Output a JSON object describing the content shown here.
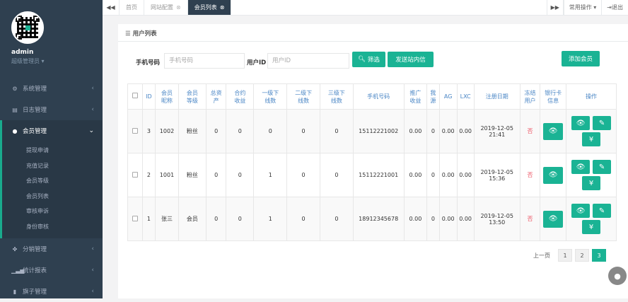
{
  "user": {
    "name": "admin",
    "role": "超级管理员 ▾"
  },
  "nav": [
    {
      "icon": "gear-icon",
      "glyph": "⚙",
      "label": "系统管理",
      "chev": "‹",
      "active": false
    },
    {
      "icon": "calendar-icon",
      "glyph": "▤",
      "label": "日志管理",
      "chev": "‹",
      "active": false
    },
    {
      "icon": "user-icon",
      "glyph": "●",
      "label": "会员管理",
      "chev": "⌄",
      "active": true
    },
    {
      "icon": "share-icon",
      "glyph": "✤",
      "label": "分销管理",
      "chev": "‹",
      "active": false
    },
    {
      "icon": "chart-icon",
      "glyph": "▁▃▅",
      "label": "统计报表",
      "chev": "‹",
      "active": false
    },
    {
      "icon": "book-icon",
      "glyph": "▮",
      "label": "旗子管理",
      "chev": "‹",
      "active": false
    }
  ],
  "submenu": [
    "提现申请",
    "充值记录",
    "会员等级",
    "会员列表",
    "审核申诉",
    "身份审核"
  ],
  "topbar": {
    "back": "◀◀",
    "forward": "▶▶",
    "tabs": [
      {
        "label": "首页",
        "close": ""
      },
      {
        "label": "网站配置",
        "close": "⊗"
      },
      {
        "label": "会员列表",
        "close": "⊗"
      }
    ],
    "common_ops": "常用操作 ▾",
    "logout": "⇥退出"
  },
  "panel": {
    "title": "用户列表",
    "title_icon": "☰"
  },
  "filter": {
    "phone_label": "手机号码",
    "phone_placeholder": "手机号码",
    "uid_label": "用户ID",
    "uid_placeholder": "用户ID",
    "filter_btn": "筛选",
    "send_btn": "发送站内信",
    "add_btn": "添加会员"
  },
  "table": {
    "headers": [
      "ID",
      "会员\n昵称",
      "会员\n等级",
      "总资\n产",
      "合约\n收益",
      "一级下\n线数",
      "二级下\n线数",
      "三级下\n线数",
      "手机号码",
      "推广\n收益",
      "我\n源",
      "AG",
      "LXC",
      "注册日期",
      "冻结\n用户",
      "银行卡\n信息",
      "操作"
    ],
    "rows": [
      {
        "id": "3",
        "nick": "1002",
        "level": "粉丝",
        "assets": "0",
        "contract": "0",
        "l1": "0",
        "l2": "0",
        "l3": "0",
        "phone": "15112221002",
        "promo": "0.00",
        "src": "0",
        "ag": "0.00",
        "lxc": "0.00",
        "date": "2019-12-05\n21:41",
        "frozen": "否"
      },
      {
        "id": "2",
        "nick": "1001",
        "level": "粉丝",
        "assets": "0",
        "contract": "0",
        "l1": "1",
        "l2": "0",
        "l3": "0",
        "phone": "15112221001",
        "promo": "0.00",
        "src": "0",
        "ag": "0.00",
        "lxc": "0.00",
        "date": "2019-12-05\n15:36",
        "frozen": "否"
      },
      {
        "id": "1",
        "nick": "张三",
        "level": "会员",
        "assets": "0",
        "contract": "0",
        "l1": "1",
        "l2": "0",
        "l3": "0",
        "phone": "18912345678",
        "promo": "0.00",
        "src": "0",
        "ag": "0.00",
        "lxc": "0.00",
        "date": "2019-12-05\n13:50",
        "frozen": "否"
      }
    ]
  },
  "pager": {
    "prev": "上一页",
    "pages": [
      "1",
      "2",
      "3"
    ],
    "current": "3"
  },
  "colors": {
    "sidebar": "#2f4050",
    "accent": "#1ab394",
    "danger": "#ed5565"
  }
}
